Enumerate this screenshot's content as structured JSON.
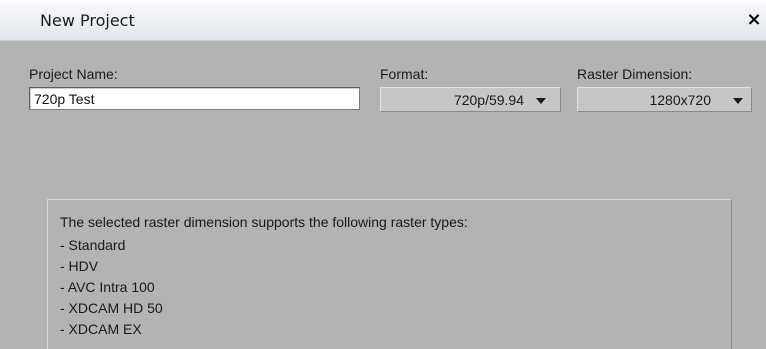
{
  "window": {
    "title": "New Project",
    "close_label": "×"
  },
  "project_name": {
    "label": "Project Name:",
    "value": "720p Test"
  },
  "format": {
    "label": "Format:",
    "selected": "720p/59.94"
  },
  "raster_dimension": {
    "label": "Raster Dimension:",
    "selected": "1280x720"
  },
  "info": {
    "heading": "The selected raster dimension supports the following raster types:",
    "raster_types": [
      "- Standard",
      "- HDV",
      "- AVC Intra 100",
      "- XDCAM HD 50",
      "- XDCAM EX"
    ]
  },
  "icons": {
    "close": "close-icon",
    "dropdown": "chevron-down-icon"
  }
}
